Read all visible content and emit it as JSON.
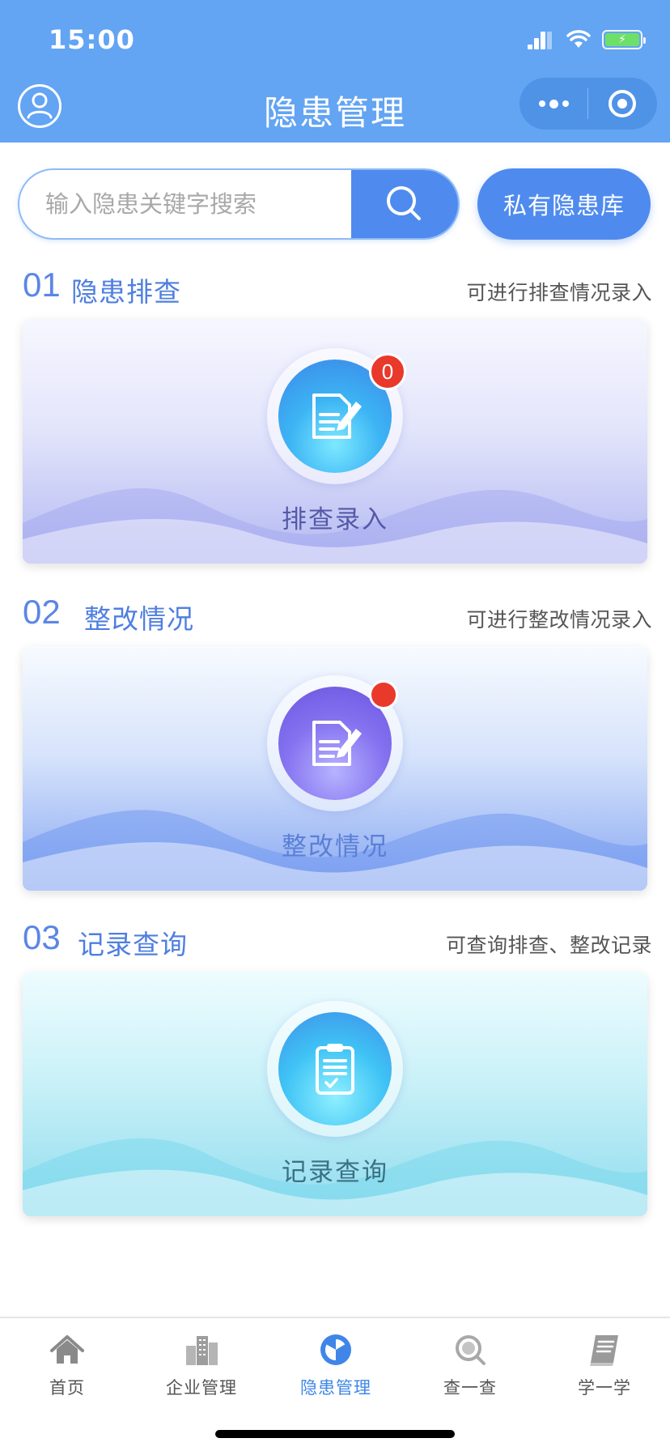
{
  "status_bar": {
    "time": "15:00"
  },
  "header": {
    "title": "隐患管理"
  },
  "search": {
    "placeholder": "输入隐患关键字搜索",
    "private_library_label": "私有隐患库"
  },
  "sections": [
    {
      "number": "01",
      "title": "隐患排查",
      "description": "可进行排查情况录入",
      "card_label": "排查录入",
      "badge_count": "0"
    },
    {
      "number": "02",
      "title": "整改情况",
      "description": "可进行整改情况录入",
      "card_label": "整改情况"
    },
    {
      "number": "03",
      "title": "记录查询",
      "description": "可查询排查、整改记录",
      "card_label": "记录查询"
    }
  ],
  "tab_bar": {
    "active": "隐患管理",
    "items": [
      {
        "label": "首页",
        "icon": "home-icon"
      },
      {
        "label": "企业管理",
        "icon": "buildings-icon"
      },
      {
        "label": "隐患管理",
        "icon": "hazard-icon"
      },
      {
        "label": "查一查",
        "icon": "magnifier-icon"
      },
      {
        "label": "学一学",
        "icon": "book-icon"
      }
    ]
  },
  "colors": {
    "header": "#63a4f3",
    "accent": "#4f8bee",
    "badge": "#e8392b",
    "tab_active": "#3f86e8"
  }
}
